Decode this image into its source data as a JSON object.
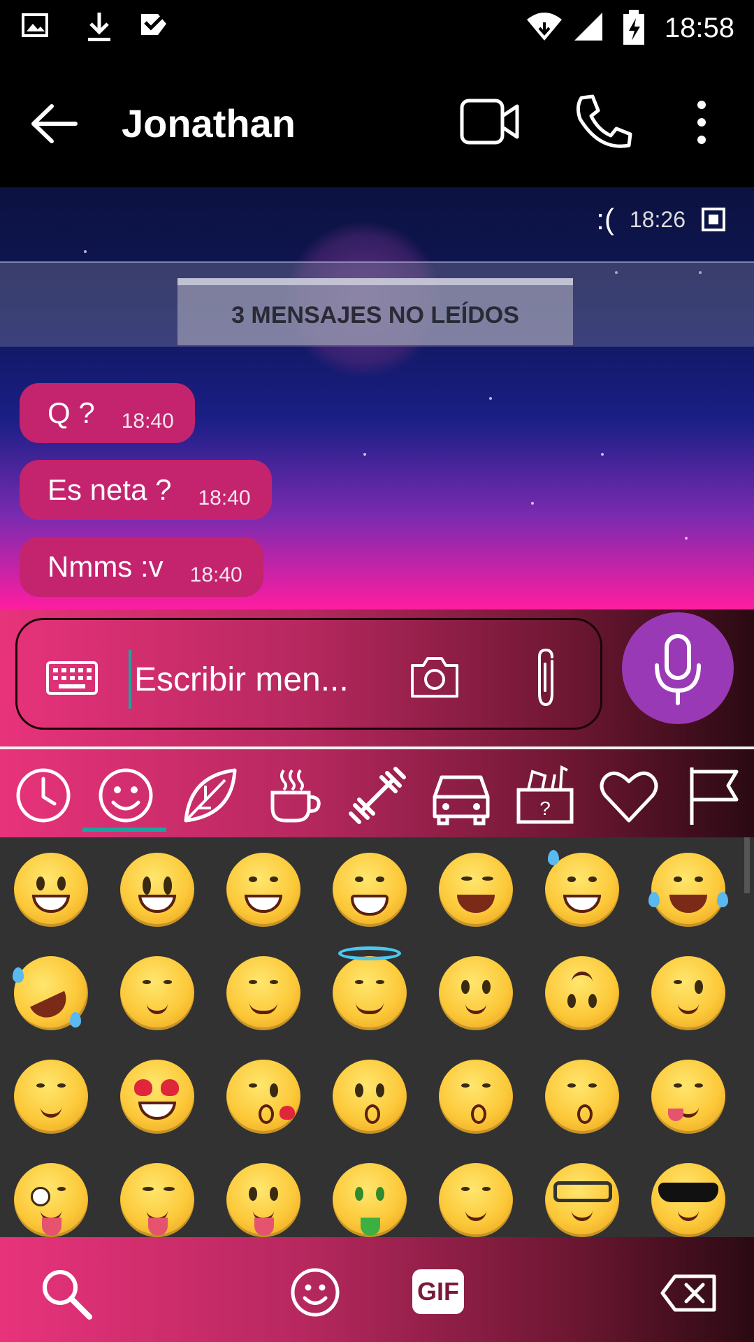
{
  "status_bar": {
    "time": "18:58",
    "icons": [
      "image-icon",
      "download-icon",
      "check-box-icon",
      "wifi-icon",
      "signal-icon",
      "battery-charging-icon"
    ]
  },
  "header": {
    "contact_name": "Jonathan",
    "actions": [
      "back-arrow-icon",
      "video-call-icon",
      "phone-icon",
      "more-vert-icon"
    ]
  },
  "chat": {
    "previous_message": {
      "text": ":(",
      "time": "18:26"
    },
    "unread_banner": "3 MENSAJES NO LEÍDOS",
    "messages": [
      {
        "text": "Q ?",
        "time": "18:40"
      },
      {
        "text": "Es neta ?",
        "time": "18:40"
      },
      {
        "text": "Nmms :v",
        "time": "18:40"
      }
    ]
  },
  "composer": {
    "placeholder": "Escribir men...",
    "icons": [
      "keyboard-icon",
      "camera-icon",
      "paperclip-icon",
      "microphone-icon"
    ]
  },
  "emoji_panel": {
    "categories": [
      "recent-icon",
      "smiley-icon",
      "nature-leaf-icon",
      "food-coffee-icon",
      "activity-dumbbell-icon",
      "travel-car-icon",
      "objects-icon",
      "symbols-heart-icon",
      "flags-icon"
    ],
    "selected_category": "smiley-icon",
    "emojis": [
      [
        "grinning",
        "smiley",
        "smile",
        "grin",
        "laughing",
        "sweat-smile",
        "joy"
      ],
      [
        "rofl",
        "relaxed",
        "blush",
        "innocent",
        "slight-smile",
        "upside-down",
        "wink"
      ],
      [
        "relieved",
        "heart-eyes",
        "kissing-heart",
        "kissing",
        "kissing-smiling-eyes",
        "kissing-closed-eyes",
        "yum"
      ],
      [
        "stuck-out-tongue-winking",
        "stuck-out-tongue-closed-eyes",
        "stuck-out-tongue",
        "money-mouth",
        "hugging",
        "nerd",
        "sunglasses"
      ]
    ]
  },
  "bottom_bar": {
    "gif_label": "GIF",
    "icons": [
      "search-icon",
      "emoji-icon",
      "backspace-icon"
    ]
  },
  "colors": {
    "bubble": "#c4236e",
    "accent": "#19a6a0",
    "mic_button": "#9a39b6",
    "emoji_panel_bg": "#323232"
  }
}
